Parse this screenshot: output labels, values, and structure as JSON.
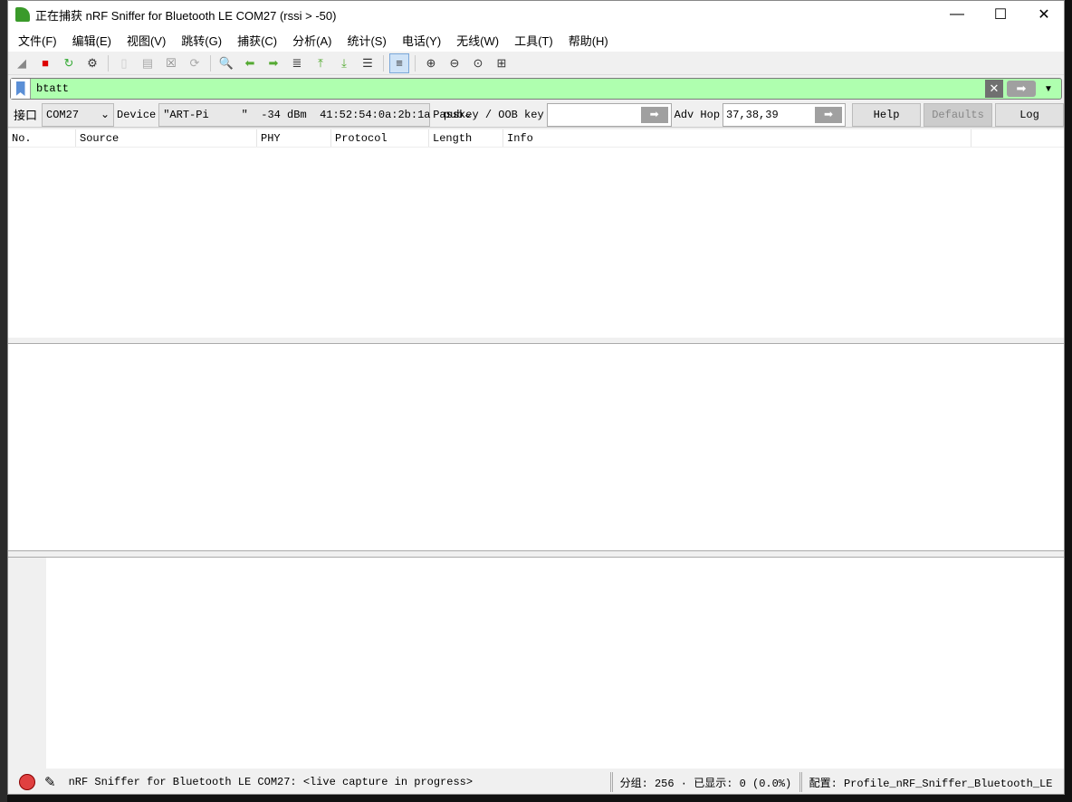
{
  "window": {
    "title": "正在捕获 nRF Sniffer for Bluetooth LE COM27 (rssi > -50)",
    "minimize": "—",
    "maximize": "☐",
    "close": "✕"
  },
  "menu": [
    "文件(F)",
    "编辑(E)",
    "视图(V)",
    "跳转(G)",
    "捕获(C)",
    "分析(A)",
    "统计(S)",
    "电话(Y)",
    "无线(W)",
    "工具(T)",
    "帮助(H)"
  ],
  "toolbar": [
    "shark-fin-icon",
    "stop-icon",
    "restart-icon",
    "options-icon",
    "open-icon",
    "save-icon",
    "close-file-icon",
    "reload-icon",
    "find-icon",
    "back-icon",
    "forward-icon",
    "goto-icon",
    "first-icon",
    "last-icon",
    "autoscroll-icon",
    "colorize-icon",
    "zoom-in-icon",
    "zoom-out-icon",
    "zoom-normal-icon",
    "resize-columns-icon"
  ],
  "filter": {
    "value": "btatt",
    "accent": "#afffaf"
  },
  "iface": {
    "label": "接口",
    "port": "COM27",
    "device_label": "Device",
    "device": "\"ART-Pi     \"  -34 dBm  41:52:54:0a:2b:1a  pub",
    "passkey_label": "Passkey / OOB key",
    "passkey": "",
    "advhop_label": "Adv Hop",
    "advhop": "37,38,39",
    "help": "Help",
    "defaults": "Defaults",
    "log": "Log"
  },
  "columns": [
    "No.",
    "Source",
    "PHY",
    "Protocol",
    "Length",
    "Info"
  ],
  "status": {
    "text": "nRF Sniffer for Bluetooth LE COM27: <live capture in progress>",
    "packets": "分组: 256 · 已显示: 0 (0.0%)",
    "profile": "配置: Profile_nRF_Sniffer_Bluetooth_LE"
  }
}
